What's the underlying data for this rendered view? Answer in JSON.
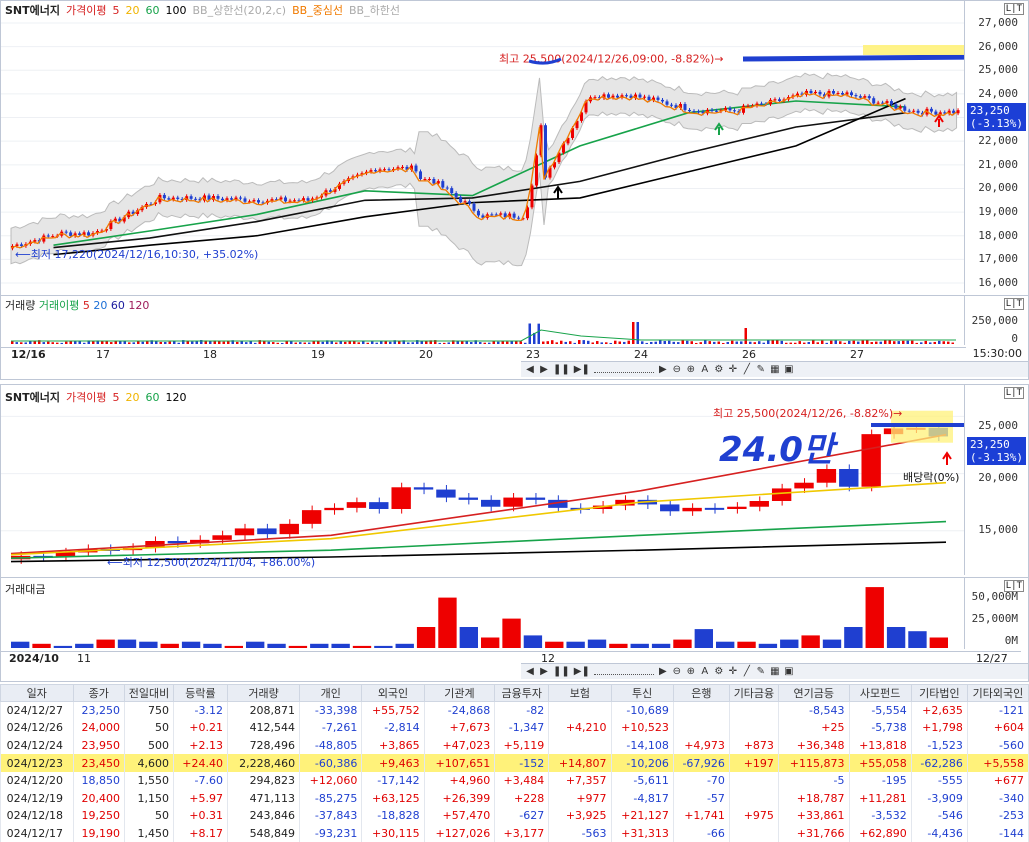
{
  "top_chart": {
    "title": "SNT에너지",
    "legend": [
      "가격이평",
      "5",
      "20",
      "60",
      "100",
      "BB_상한선(20,2,c)",
      "BB_중심선",
      "BB_하한선"
    ],
    "legend_colors": [
      "#d62020",
      "#d62020",
      "#f0b400",
      "#17a34a",
      "#000000",
      "#aaaaaa",
      "#f07a00",
      "#aaaaaa"
    ],
    "max_annotation": "최고 25,500(2024/12/26,09:00, -8.82%)",
    "min_annotation": "최저 17,220(2024/12/16,10:30, +35.02%)",
    "price_label": "23,250",
    "change_label": "(-3.13%)",
    "yticks": [
      "27,000",
      "26,000",
      "25,000",
      "24,000",
      "23,000",
      "22,000",
      "21,000",
      "20,000",
      "19,000",
      "18,000",
      "17,000",
      "16,000"
    ],
    "volume_title": "거래량",
    "volume_legend": [
      "거래이평",
      "5",
      "20",
      "60",
      "120"
    ],
    "volume_ticks": [
      "250,000",
      "0"
    ],
    "dates": [
      "12/16",
      "17",
      "18",
      "19",
      "20",
      "23",
      "24",
      "26",
      "27"
    ],
    "time_label": "15:30:00"
  },
  "bottom_chart": {
    "title": "SNT에너지",
    "legend": [
      "가격이평",
      "5",
      "20",
      "60",
      "120"
    ],
    "max_annotation": "최고 25,500(2024/12/26, -8.82%)",
    "min_annotation": "최저 12,500(2024/11/04, +86.00%)",
    "price_label": "23,250",
    "change_label": "(-3.13%)",
    "dividend_label": "배당락(0%)",
    "handwritten": "24.0만",
    "yticks": [
      "25,000",
      "20,000",
      "15,000"
    ],
    "amount_title": "거래대금",
    "amount_ticks": [
      "50,000M",
      "25,000M",
      "0M"
    ],
    "dates": [
      "2024/10",
      "11",
      "12",
      "12/27"
    ]
  },
  "chart_data": [
    {
      "type": "candlestick",
      "title": "SNT에너지",
      "interval": "intraday",
      "ylim": [
        16000,
        27000
      ],
      "x": [
        "12/16",
        "12/17",
        "12/18",
        "12/19",
        "12/20",
        "12/23",
        "12/24",
        "12/26",
        "12/27"
      ],
      "close": [
        18100,
        19600,
        19500,
        20850,
        18850,
        23950,
        23300,
        24000,
        23250
      ],
      "high": [
        18400,
        20200,
        19800,
        21000,
        20400,
        24500,
        24200,
        25500,
        23950
      ],
      "low": [
        17220,
        18000,
        18800,
        18300,
        18700,
        19200,
        23000,
        23500,
        22800
      ],
      "series": [
        {
          "name": "5",
          "values": [
            17800,
            19000,
            19500,
            20500,
            19200,
            23500,
            23700,
            23900,
            23400
          ]
        },
        {
          "name": "20",
          "values": [
            17600,
            18200,
            18900,
            19900,
            19700,
            21800,
            23200,
            23700,
            23450
          ]
        },
        {
          "name": "60",
          "values": [
            17500,
            17900,
            18600,
            19500,
            19600,
            20300,
            21500,
            22600,
            23200
          ]
        },
        {
          "name": "100",
          "values": [
            17200,
            17600,
            18000,
            18800,
            19400,
            19600,
            20700,
            21800,
            23800
          ]
        }
      ]
    },
    {
      "type": "candlestick",
      "title": "SNT에너지",
      "interval": "daily",
      "ylim": [
        12000,
        26000
      ],
      "x": [
        "2024/10",
        "11",
        "12",
        "12/27"
      ],
      "close": [
        12800,
        14800,
        18800,
        23250
      ],
      "series": [
        {
          "name": "5",
          "values": [
            13000,
            14600,
            18500,
            23400
          ]
        },
        {
          "name": "20",
          "values": [
            12900,
            14300,
            17500,
            19200
          ]
        },
        {
          "name": "60",
          "values": [
            12600,
            13300,
            14600,
            15800
          ]
        },
        {
          "name": "120",
          "values": [
            12300,
            12700,
            13300,
            14000
          ]
        }
      ]
    },
    {
      "type": "table",
      "columns": [
        "일자",
        "종가",
        "전일대비",
        "등락률",
        "거래량",
        "개인",
        "외국인",
        "기관계",
        "금융투자",
        "보험",
        "투신",
        "은행",
        "기타금융",
        "연기금등",
        "사모펀드",
        "기타법인",
        "기타외국인"
      ],
      "rows": [
        [
          "024/12/27",
          "23,250",
          "750",
          "-3.12",
          "208,871",
          "-33,398",
          "+55,752",
          "-24,868",
          "-82",
          "",
          "-10,689",
          "",
          "",
          "-8,543",
          "-5,554",
          "+2,635",
          "-121"
        ],
        [
          "024/12/26",
          "24,000",
          "50",
          "+0.21",
          "412,544",
          "-7,261",
          "-2,814",
          "+7,673",
          "-1,347",
          "+4,210",
          "+10,523",
          "",
          "",
          "+25",
          "-5,738",
          "+1,798",
          "+604"
        ],
        [
          "024/12/24",
          "23,950",
          "500",
          "+2.13",
          "728,496",
          "-48,805",
          "+3,865",
          "+47,023",
          "+5,119",
          "",
          "-14,108",
          "+4,973",
          "+873",
          "+36,348",
          "+13,818",
          "-1,523",
          "-560"
        ],
        [
          "024/12/23",
          "23,450",
          "4,600",
          "+24.40",
          "2,228,460",
          "-60,386",
          "+9,463",
          "+107,651",
          "-152",
          "+14,807",
          "-10,206",
          "-67,926",
          "+197",
          "+115,873",
          "+55,058",
          "-62,286",
          "+5,558"
        ],
        [
          "024/12/20",
          "18,850",
          "1,550",
          "-7.60",
          "294,823",
          "+12,060",
          "-17,142",
          "+4,960",
          "+3,484",
          "+7,357",
          "-5,611",
          "-70",
          "",
          "-5",
          "-195",
          "-555",
          "+677"
        ],
        [
          "024/12/19",
          "20,400",
          "1,150",
          "+5.97",
          "471,113",
          "-85,275",
          "+63,125",
          "+26,399",
          "+228",
          "+977",
          "-4,817",
          "-57",
          "",
          "+18,787",
          "+11,281",
          "-3,909",
          "-340"
        ],
        [
          "024/12/18",
          "19,250",
          "50",
          "+0.31",
          "243,846",
          "-37,843",
          "-18,828",
          "+57,470",
          "-627",
          "+3,925",
          "+21,127",
          "+1,741",
          "+975",
          "+33,861",
          "-3,532",
          "-546",
          "-253"
        ],
        [
          "024/12/17",
          "19,190",
          "1,450",
          "+8.17",
          "548,849",
          "-93,231",
          "+30,115",
          "+127,026",
          "+3,177",
          "-563",
          "+31,313",
          "-66",
          "",
          "+31,766",
          "+62,890",
          "-4,436",
          "-144"
        ]
      ]
    }
  ]
}
